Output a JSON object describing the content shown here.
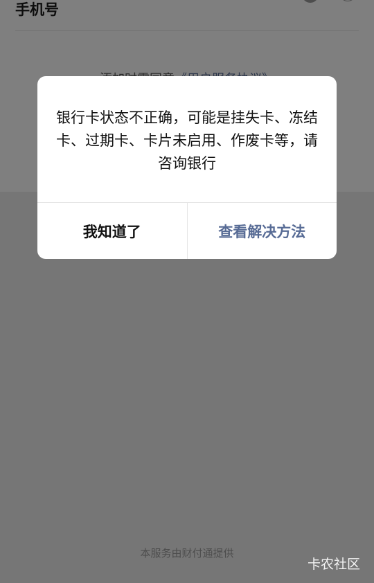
{
  "form": {
    "phone_label": "手机号"
  },
  "agreement": {
    "prefix": "添加时需同意",
    "link": "《用户服务协议》"
  },
  "dialog": {
    "message": "银行卡状态不正确，可能是挂失卡、冻结卡、过期卡、卡片未启用、作废卡等，请咨询银行",
    "confirm_label": "我知道了",
    "help_label": "查看解决方法"
  },
  "footer": {
    "provider": "本服务由财付通提供"
  },
  "watermark": {
    "text": "卡农社区"
  }
}
